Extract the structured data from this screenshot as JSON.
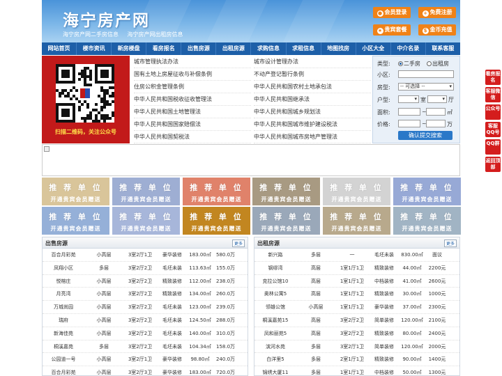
{
  "header": {
    "logo": "海宁房产网",
    "tagline": [
      "海宁房产网二手房信息",
      "海宁房产网出租房信息"
    ],
    "buttons": [
      {
        "label": "会员登录",
        "icon": "user-icon"
      },
      {
        "label": "免费注册",
        "icon": "register-icon"
      },
      {
        "label": "贵宾套餐",
        "icon": "vip-icon"
      },
      {
        "label": "金币充值",
        "icon": "coin-icon"
      }
    ]
  },
  "nav": [
    "网站首页",
    "楼市资讯",
    "新房楼盘",
    "看房报名",
    "出售房源",
    "出租房源",
    "求购信息",
    "求租信息",
    "地图找房",
    "小区大全",
    "中介名录",
    "联系客服"
  ],
  "qr": {
    "caption": "扫描二维码，关注公众号"
  },
  "links": {
    "left": [
      "城市管理执法办法",
      "国有土地上房屋征收与补偿条例",
      "住房公积金管理条例",
      "中华人民共和国税收征收管理法",
      "中华人民共和国土地管理法",
      "中华人民共和国国家赔偿法",
      "中华人民共和国契税法"
    ],
    "right": [
      "城市设计管理办法",
      "不动产登记暂行条例",
      "中华人民共和国农村土地承包法",
      "中华人民共和国继承法",
      "中华人民共和国城乡规划法",
      "中华人民共和国城市维护建设税法",
      "中华人民共和国城市房地产管理法"
    ]
  },
  "search": {
    "type_label": "类型:",
    "type_options": [
      "二手房",
      "出租房"
    ],
    "community_label": "小区:",
    "house_label": "房型:",
    "house_placeholder": "-- 可选择 --",
    "layout_label": "户型:",
    "room_unit": "室",
    "hall_unit": "厅",
    "area_label": "面积:",
    "area_unit": "㎡",
    "price_label": "价格:",
    "price_unit": "万",
    "submit": "确认提交搜索"
  },
  "ads": {
    "title": "推 荐 单 位",
    "subtitle": "开通贵宾会员赠送",
    "colors": [
      "#d9c59a",
      "#9eaed3",
      "#e0826a",
      "#a89a82",
      "#d3d3d3",
      "#97a9d6",
      "#95b0d8",
      "#a7b6da",
      "#c28620",
      "#9aa8b9",
      "#b8a98c",
      "#a1b4c4"
    ]
  },
  "sale": {
    "title": "出售房源",
    "more": "更多",
    "rows": [
      [
        "百合月彩苑",
        "小高层",
        "3室2厅1卫",
        "豪华装修",
        "183.00㎡",
        "580.0万"
      ],
      [
        "凤翔小区",
        "多层",
        "3室2厅2卫",
        "毛坯未装",
        "113.63㎡",
        "155.0万"
      ],
      [
        "悦榕庄",
        "小高层",
        "3室2厅2卫",
        "精致装修",
        "112.00㎡",
        "238.0万"
      ],
      [
        "月亮湾",
        "小高层",
        "3室2厅2卫",
        "精致装修",
        "134.00㎡",
        "260.0万"
      ],
      [
        "万城尚园",
        "小高层",
        "3室2厅2卫",
        "毛坯未装",
        "123.00㎡",
        "239.0万"
      ],
      [
        "瑞府",
        "小高层",
        "3室2厅2卫",
        "毛坯未装",
        "124.50㎡",
        "288.0万"
      ],
      [
        "新海佳苑",
        "小高层",
        "3室2厅2卫",
        "毛坯未装",
        "140.00㎡",
        "310.0万"
      ],
      [
        "桐溪嘉苑",
        "多层",
        "3室2厅2卫",
        "毛坯未装",
        "104.34㎡",
        "158.0万"
      ],
      [
        "公园道一号",
        "小高层",
        "3室2厅1卫",
        "豪华装修",
        "98.80㎡",
        "240.0万"
      ],
      [
        "百合月彩苑",
        "小高层",
        "3室2厅3卫",
        "豪华装修",
        "183.00㎡",
        "720.0万"
      ]
    ]
  },
  "rent": {
    "title": "出租房源",
    "more": "更多",
    "rows": [
      [
        "新兴路",
        "多层",
        "一",
        "毛坯未装",
        "830.00㎡",
        "面议"
      ],
      [
        "钢缪湾",
        "高层",
        "1室1厅1卫",
        "精致装修",
        "44.00㎡",
        "2200元"
      ],
      [
        "克拉公馆10",
        "高层",
        "1室1厅1卫",
        "中档装修",
        "41.00㎡",
        "2600元"
      ],
      [
        "奥林公寓5",
        "高层",
        "1室1厅1卫",
        "精致装修",
        "30.00㎡",
        "1000元"
      ],
      [
        "领雄公馆",
        "小高层",
        "1室1厅1卫",
        "豪华装修",
        "37.00㎡",
        "2300元"
      ],
      [
        "桐溪嘉苑15",
        "高层",
        "3室2厅2卫",
        "简单装修",
        "120.00㎡",
        "2100元"
      ],
      [
        "凤和丽苑5",
        "高层",
        "3室2厅2卫",
        "精致装修",
        "80.00㎡",
        "2400元"
      ],
      [
        "滨河水苑",
        "多层",
        "3室2厅1卫",
        "简单装修",
        "120.00㎡",
        "2000元"
      ],
      [
        "白洋里5",
        "多层",
        "2室1厅1卫",
        "精致装修",
        "90.00㎡",
        "1400元"
      ],
      [
        "锦绣大厦11",
        "多层",
        "1室1厅1卫",
        "中档装修",
        "50.00㎡",
        "1300元"
      ]
    ]
  },
  "float_buttons": [
    "看房报名",
    "客服微信",
    "公众号",
    "客服QQ号",
    "QQ群",
    "返回顶部"
  ]
}
